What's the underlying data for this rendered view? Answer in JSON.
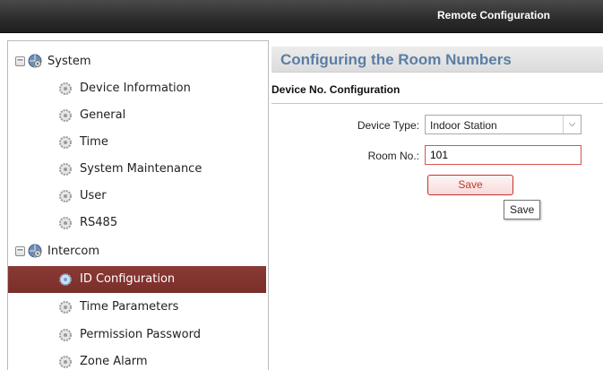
{
  "window": {
    "title": "Remote Configuration"
  },
  "sidebar": {
    "groups": [
      {
        "label": "System",
        "toggle": "−",
        "items": [
          {
            "label": "Device Information"
          },
          {
            "label": "General"
          },
          {
            "label": "Time"
          },
          {
            "label": "System Maintenance"
          },
          {
            "label": "User"
          },
          {
            "label": "RS485"
          }
        ]
      },
      {
        "label": "Intercom",
        "toggle": "−",
        "items": [
          {
            "label": "ID Configuration",
            "selected": true
          },
          {
            "label": "Time Parameters"
          },
          {
            "label": "Permission Password"
          },
          {
            "label": "Zone Alarm"
          }
        ]
      }
    ],
    "selected_color": "#7e312d"
  },
  "main": {
    "header": "Configuring the Room Numbers",
    "section": "Device No. Configuration",
    "device_type": {
      "label": "Device Type:",
      "value": "Indoor Station"
    },
    "room_no": {
      "label": "Room No.:",
      "value": "101"
    },
    "save_label": "Save",
    "tooltip": "Save"
  },
  "icons": {
    "group": "globe-gear-icon",
    "item": "gear-icon",
    "toggle": "minus-icon",
    "dropdown": "chevron-down-icon"
  }
}
